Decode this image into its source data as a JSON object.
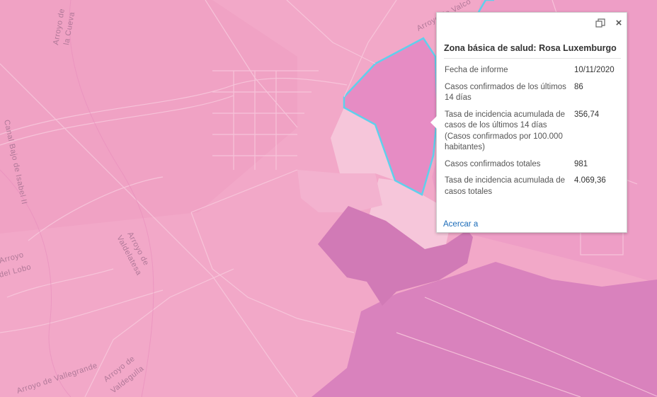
{
  "map": {
    "labels": {
      "arroyo_cueva": [
        "Arroyo de",
        "la Cueva"
      ],
      "arroyo_valco": "Arroyo de Valco",
      "canal": "Canal Bajo de Isabel II",
      "arroyo_valdelatesa": [
        "Arroyo de",
        "Valdelatesa"
      ],
      "arroyo_valdelobo": [
        "Arroyo",
        "del Lobo"
      ],
      "arroyo_valle": "Arroyo de Vallegrande",
      "arroyo_valdegulla": [
        "Arroyo de",
        "Valdegulla"
      ]
    },
    "colors": {
      "base": "#f2a8c8",
      "zone_light": "#f6c6da",
      "zone_mid": "#ea93c0",
      "zone_dark": "#d57ab8",
      "zone_selected": "#e68cc4",
      "selection_outline": "#5fd0ec"
    }
  },
  "popup": {
    "title": "Zona básica de salud: Rosa Luxemburgo",
    "rows": [
      {
        "name": "Fecha de informe",
        "value": "10/11/2020"
      },
      {
        "name": "Casos confirmados de los últimos 14 días",
        "value": "86"
      },
      {
        "name": "Tasa de incidencia acumulada de casos de los últimos 14 días (Casos confirmados por 100.000 habitantes)",
        "value": "356,74"
      },
      {
        "name": "Casos confirmados totales",
        "value": "981"
      },
      {
        "name": "Tasa de incidencia acumulada de casos totales",
        "value": "4.069,36"
      }
    ],
    "zoom_link": "Acercar a",
    "close_glyph": "×"
  }
}
